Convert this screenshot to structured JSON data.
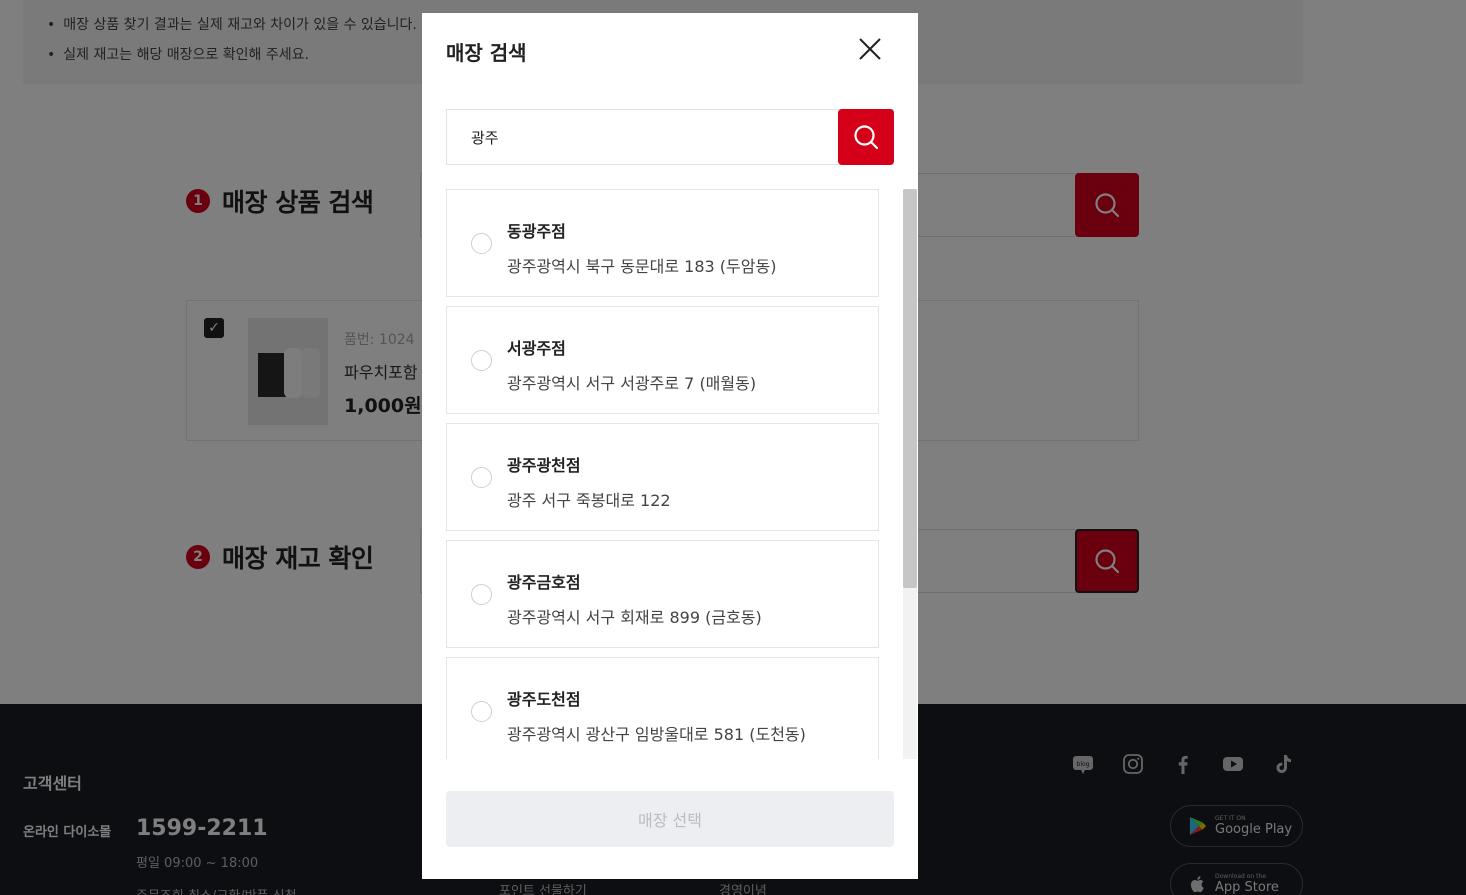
{
  "notice": {
    "lines": [
      "매장 상품 찾기 결과는 실제 재고와 차이가 있을 수 있습니다.",
      "실제 재고는 해당 매장으로 확인해 주세요."
    ]
  },
  "steps": [
    {
      "num": "1",
      "label": "매장 상품 검색"
    },
    {
      "num": "2",
      "label": "매장 재고 확인"
    }
  ],
  "product": {
    "code": "품번: 1024",
    "name": "파우치포함",
    "price": "1,000원"
  },
  "footer": {
    "cs_title": "고객센터",
    "cs_label": "온라인 다이소몰",
    "cs_phone": "1599-2211",
    "cs_hours": "평일 09:00 ~ 18:00",
    "cs_links": "주문조회    취소/교환/반품 신청",
    "link_gift": "포인트 선물하기",
    "link_mgmt": "경영이념",
    "social_icons": [
      "blog-icon",
      "instagram-icon",
      "facebook-icon",
      "youtube-icon",
      "tiktok-icon"
    ],
    "blog_label": "blog",
    "google_play": {
      "small": "GET IT ON",
      "big": "Google Play"
    },
    "app_store": {
      "small": "Download on the",
      "big": "App Store"
    }
  },
  "modal": {
    "title": "매장 검색",
    "search_value": "광주",
    "stores": [
      {
        "name": "동광주점",
        "address": "광주광역시 북구 동문대로 183 (두암동)"
      },
      {
        "name": "서광주점",
        "address": "광주광역시 서구 서광주로 7 (매월동)"
      },
      {
        "name": "광주광천점",
        "address": "광주 서구 죽봉대로 122"
      },
      {
        "name": "광주금호점",
        "address": "광주광역시 서구 회재로 899 (금호동)"
      },
      {
        "name": "광주도천점",
        "address": "광주광역시 광산구 임방울대로 581 (도천동)"
      }
    ],
    "select_label": "매장 선택"
  },
  "colors": {
    "accent": "#d4001a",
    "footer_bg": "#1a1c24",
    "disabled_bg": "#eceef1"
  }
}
